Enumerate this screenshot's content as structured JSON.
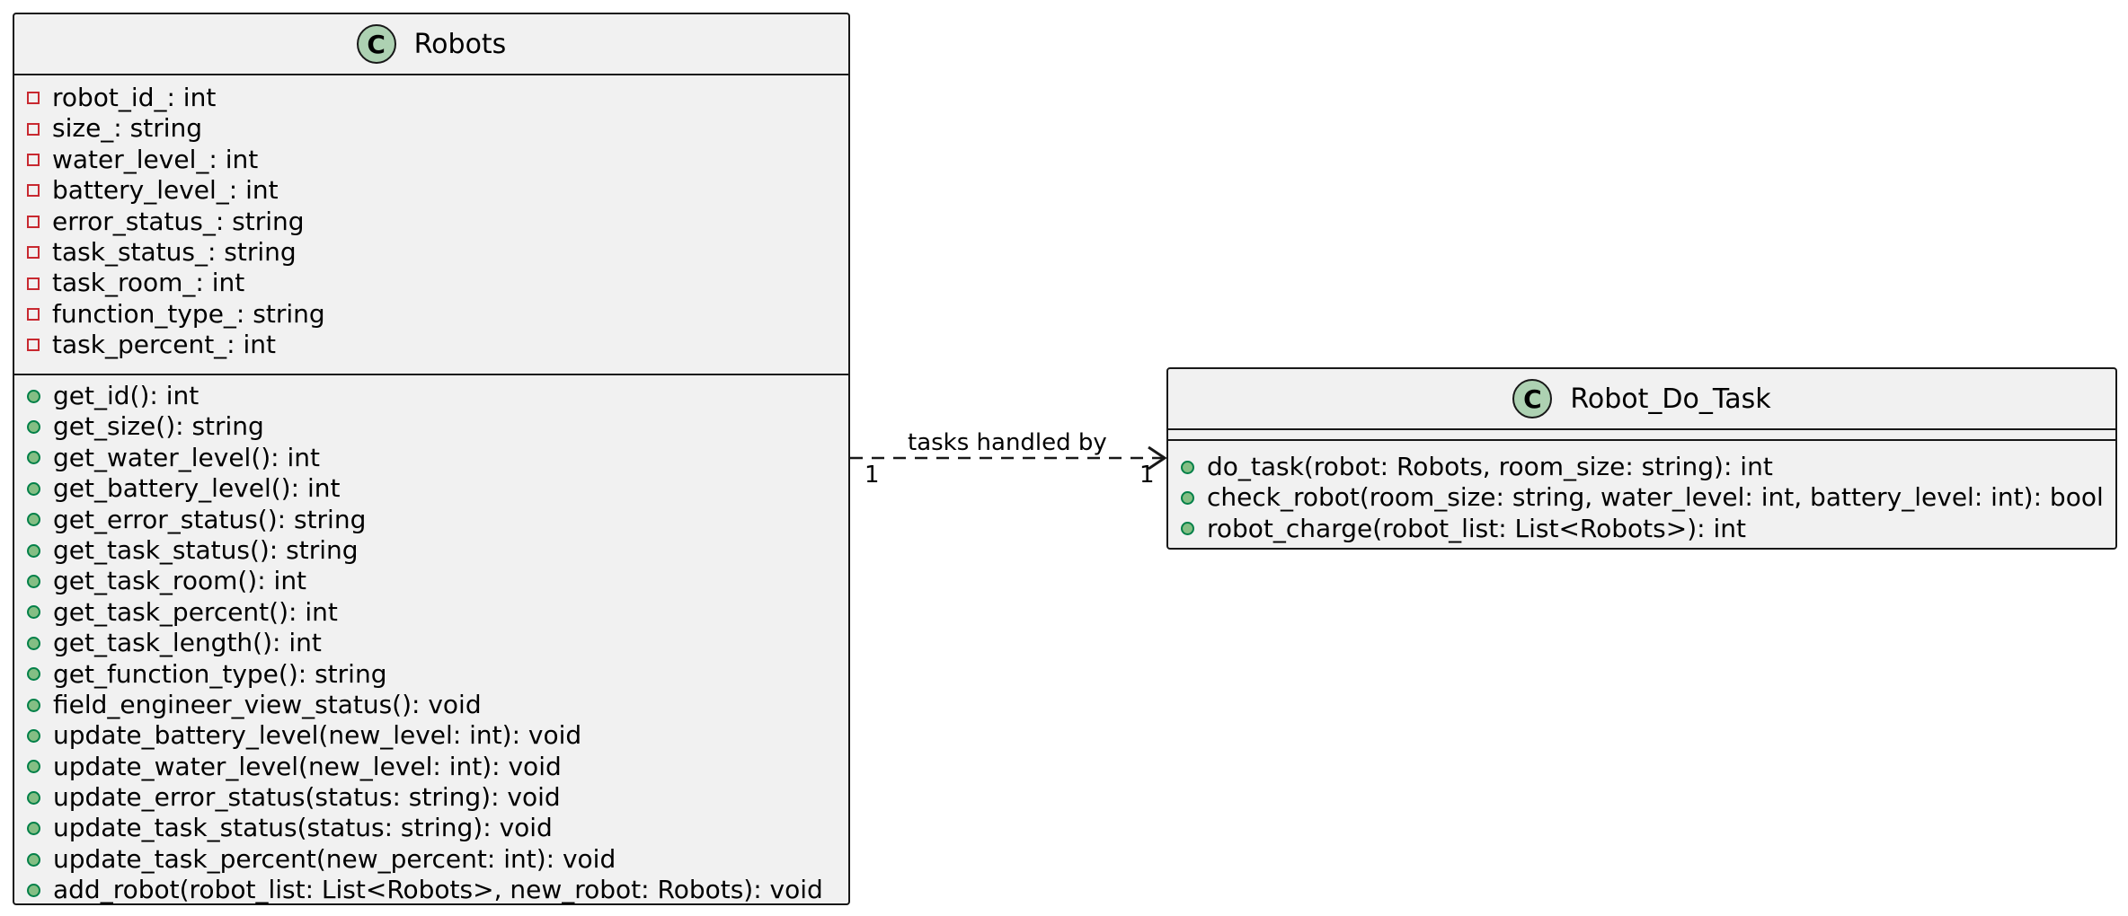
{
  "diagram": {
    "classes": [
      {
        "name": "Robots",
        "icon": "C",
        "attributes": [
          "robot_id_: int",
          "size_: string",
          "water_level_: int",
          "battery_level_: int",
          "error_status_: string",
          "task_status_: string",
          "task_room_: int",
          "function_type_: string",
          "task_percent_: int"
        ],
        "operations": [
          "get_id(): int",
          "get_size(): string",
          "get_water_level(): int",
          "get_battery_level(): int",
          "get_error_status(): string",
          "get_task_status(): string",
          "get_task_room(): int",
          "get_task_percent(): int",
          "get_task_length(): int",
          "get_function_type(): string",
          "field_engineer_view_status(): void",
          "update_battery_level(new_level: int): void",
          "update_water_level(new_level: int): void",
          "update_error_status(status: string): void",
          "update_task_status(status: string): void",
          "update_task_percent(new_percent: int): void",
          "add_robot(robot_list: List<Robots>, new_robot: Robots): void"
        ]
      },
      {
        "name": "Robot_Do_Task",
        "icon": "C",
        "attributes": [],
        "operations": [
          "do_task(robot: Robots, room_size: string): int",
          "check_robot(room_size: string, water_level: int, battery_level: int): bool",
          "robot_charge(robot_list: List<Robots>): int"
        ]
      }
    ],
    "association": {
      "label": "tasks handled by",
      "source_multiplicity": "1",
      "target_multiplicity": "1",
      "style": "dashed",
      "arrow": "open"
    }
  },
  "colors": {
    "class_fill": "#f1f1f1",
    "border": "#181818",
    "class_icon": "#add1b2",
    "private_marker": "#c82930",
    "public_marker_fill": "#84be84",
    "public_marker_stroke": "#038048"
  }
}
